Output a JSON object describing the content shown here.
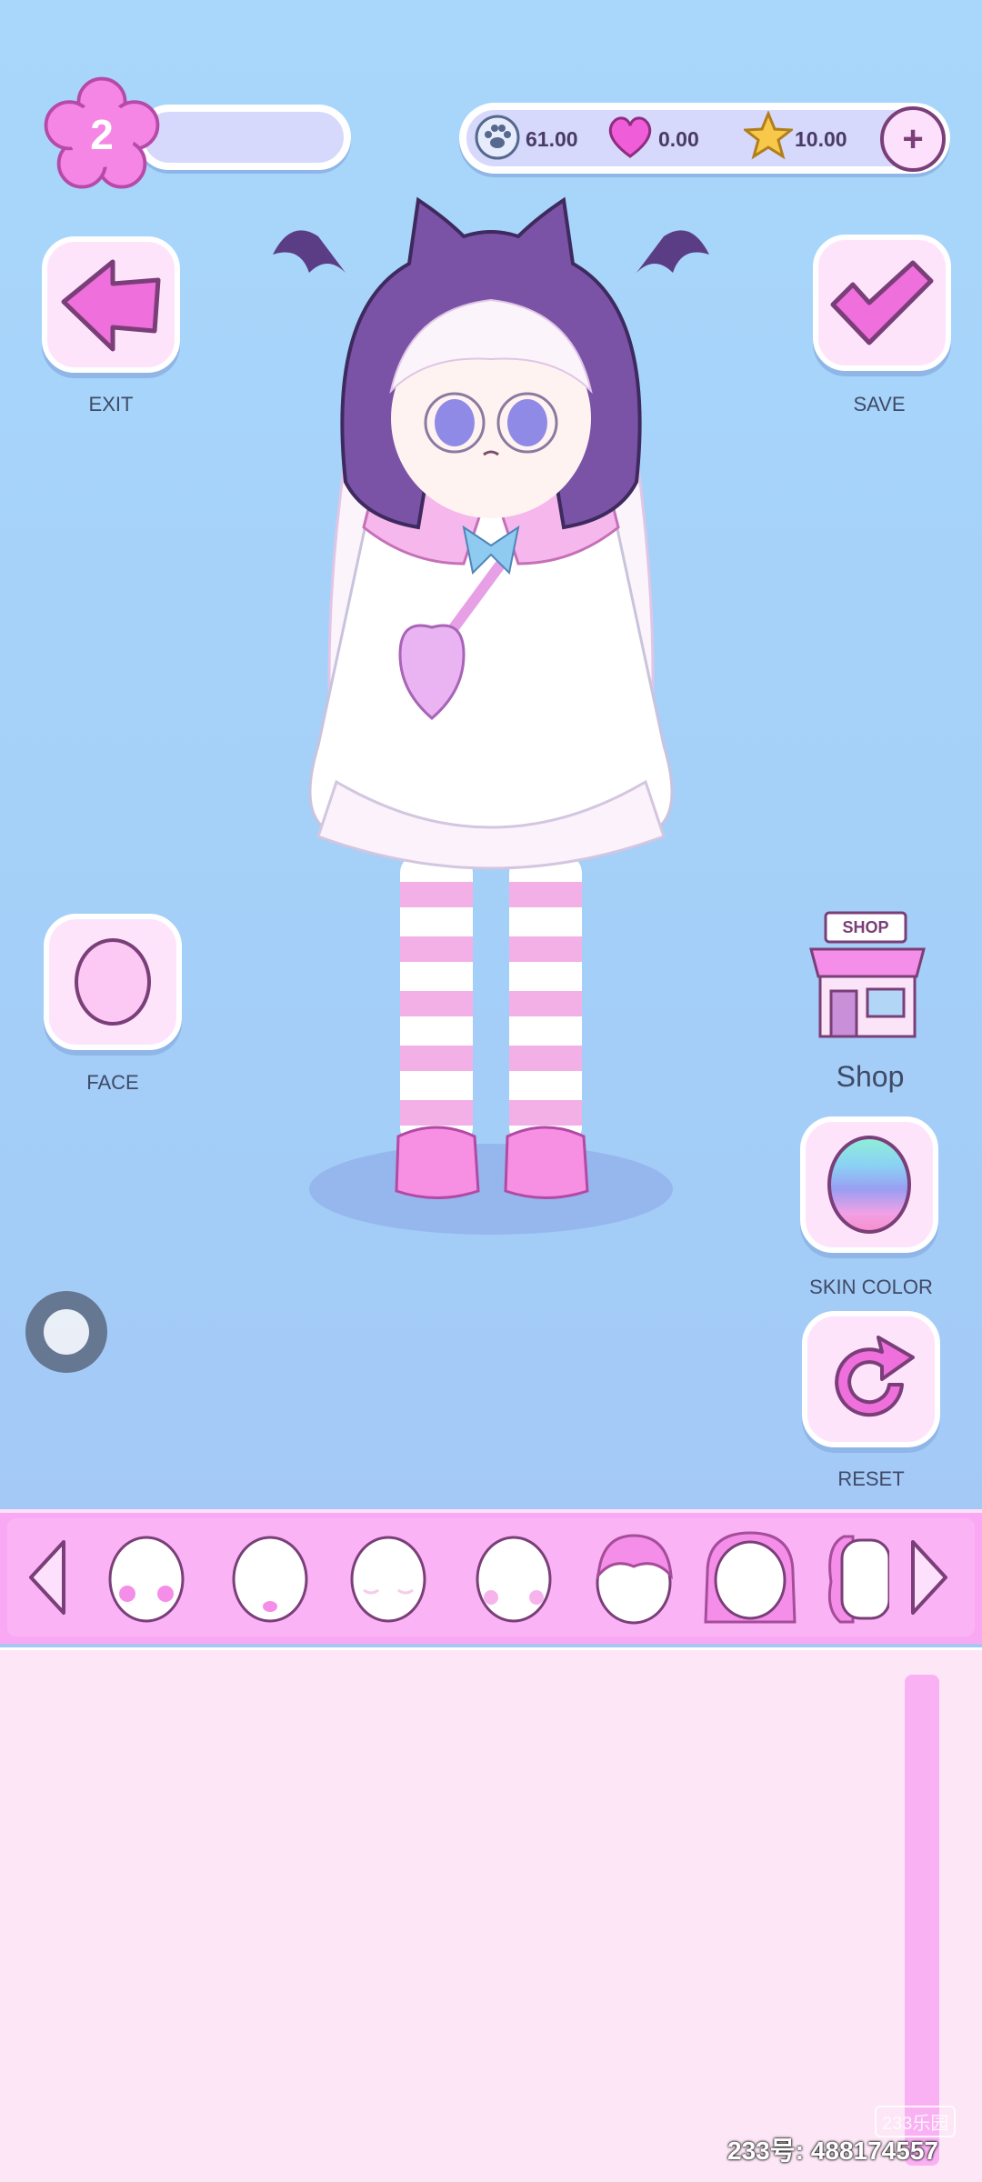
{
  "player": {
    "level": "2"
  },
  "currency": {
    "paws": "61.00",
    "hearts": "0.00",
    "stars": "10.00"
  },
  "buttons": {
    "exit": "EXIT",
    "save": "SAVE",
    "face": "FACE",
    "shop_sign": "SHOP",
    "shop": "Shop",
    "skin_color": "SKIN COLOR",
    "reset": "RESET"
  },
  "palette": {
    "primary_pink": "#f58ee9",
    "accent_purple": "#7a3f78",
    "bg_blue": "#a9d7fb"
  },
  "face_options": [
    {
      "name": "face-option-blush-circles"
    },
    {
      "name": "face-option-tongue"
    },
    {
      "name": "face-option-closed-eyes"
    },
    {
      "name": "face-option-dot-blush"
    },
    {
      "name": "face-option-pink-hair"
    },
    {
      "name": "face-option-long-hair"
    },
    {
      "name": "face-option-ponytail"
    }
  ],
  "watermark": {
    "logo": "233乐园",
    "text": "233号: 488174557"
  }
}
